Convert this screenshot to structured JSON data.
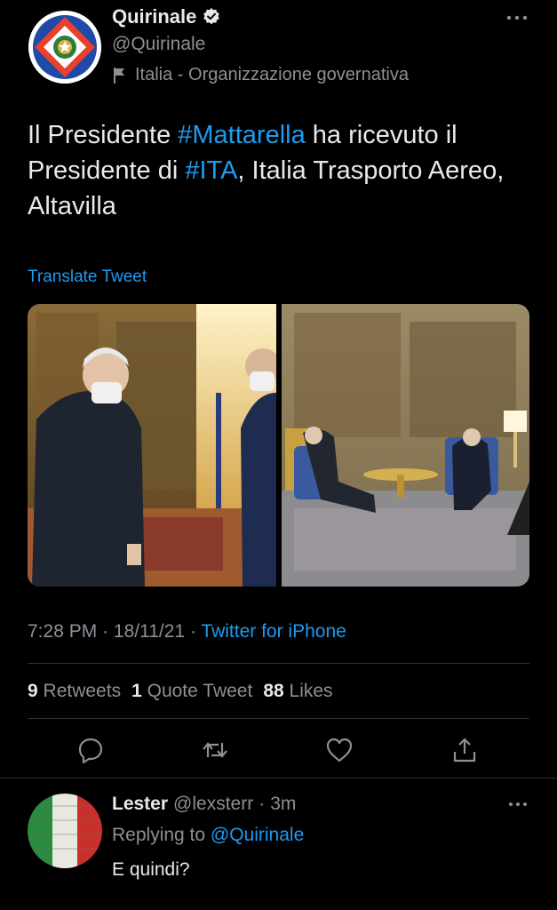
{
  "tweet": {
    "author_name": "Quirinale",
    "author_handle": "@Quirinale",
    "author_category": "Italia - Organizzazione governativa",
    "text_parts": [
      {
        "t": "Il Presidente ",
        "hash": false
      },
      {
        "t": "#Mattarella",
        "hash": true
      },
      {
        "t": " ha ricevuto il Presidente di ",
        "hash": false
      },
      {
        "t": "#ITA",
        "hash": true
      },
      {
        "t": ", Italia Trasporto Aereo, Altavilla",
        "hash": false
      }
    ],
    "translate_label": "Translate Tweet",
    "time": "7:28 PM",
    "date": "18/11/21",
    "source": "Twitter for iPhone",
    "retweets_count": "9",
    "retweets_label": "Retweets",
    "quotes_count": "1",
    "quotes_label": "Quote Tweet",
    "likes_count": "88",
    "likes_label": "Likes"
  },
  "reply": {
    "author_name": "Lester",
    "author_handle": "@lexsterr",
    "age": "3m",
    "replying_prefix": "Replying to",
    "replying_mention": "@Quirinale",
    "text": "E quindi?"
  },
  "colors": {
    "background": "#000000",
    "text": "#e7e9ea",
    "muted": "#8b9096",
    "link": "#1d9bf0",
    "divider": "#2f3336"
  },
  "icons": {
    "verified": "verified-badge-icon",
    "category": "flag-icon",
    "more": "more-options-icon",
    "actions": [
      "reply-icon",
      "retweet-icon",
      "like-icon",
      "share-icon"
    ]
  }
}
